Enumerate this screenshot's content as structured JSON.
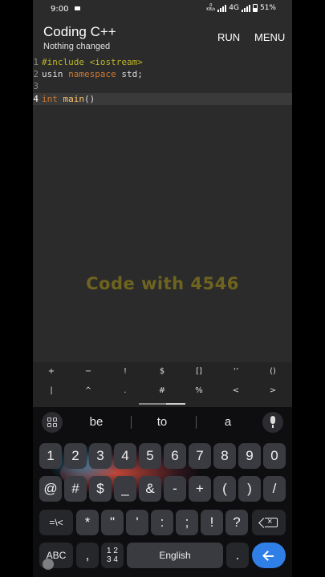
{
  "status_bar": {
    "time": "9:00",
    "net_speed_top": "0",
    "net_speed_unit": "KB/s",
    "network": "4G",
    "battery": "51%"
  },
  "app": {
    "title": "Coding C++",
    "subtitle": "Nothing changed",
    "run_label": "RUN",
    "menu_label": "MENU"
  },
  "editor": {
    "lines": [
      {
        "num": "1",
        "a": "#include <iostream>"
      },
      {
        "num": "2",
        "a": "usin ",
        "b": "namespace",
        "c": " std;"
      },
      {
        "num": "3"
      },
      {
        "num": "4",
        "a": "int",
        "b": " ",
        "c": "main",
        "d": "()"
      }
    ],
    "watermark": "Code with 4546"
  },
  "symbols": {
    "row1": [
      "+",
      "−",
      "!",
      "$",
      "[]",
      "‘’",
      "()"
    ],
    "row2": [
      "|",
      "^",
      ".",
      "#",
      "%",
      "<",
      ">"
    ]
  },
  "keyboard": {
    "suggestions": [
      "be",
      "to",
      "a"
    ],
    "numbers": [
      "1",
      "2",
      "3",
      "4",
      "5",
      "6",
      "7",
      "8",
      "9",
      "0"
    ],
    "row2": [
      "@",
      "#",
      "$",
      "_",
      "&",
      "-",
      "+",
      "(",
      ")",
      "/"
    ],
    "row3": [
      "=\\<",
      "*",
      "\"",
      "'",
      ":",
      ";",
      "!",
      "?"
    ],
    "abc": "ABC",
    "comma": ",",
    "alt_top": "1 2",
    "alt_bottom": "3 4",
    "space": "English",
    "period": "."
  },
  "colors": {
    "accent": "#2f7fe6",
    "watermark": "#6e6420",
    "keyword": "#cc7832",
    "preprocessor": "#bbb529"
  }
}
